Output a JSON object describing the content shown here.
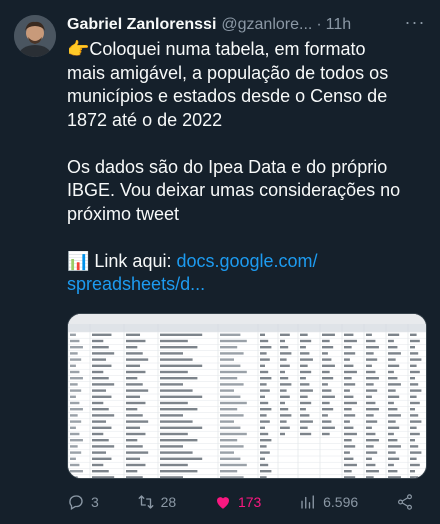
{
  "tweet": {
    "author_name": "Gabriel Zanlorenssi",
    "handle": "@gzanlore...",
    "dot": "·",
    "time": "11h",
    "more_label": "···",
    "line1": "👉Coloquei numa tabela, em formato",
    "line2": "mais amigável, a população de todos os",
    "line3": "municípios e estados desde o Censo de",
    "line4": "1872 até o de 2022",
    "line5": "Os dados são do Ipea Data e do próprio",
    "line6": "IBGE. Vou deixar umas considerações no",
    "line7": "próximo tweet",
    "link_prefix": "📊 Link aqui: ",
    "link_line1": "docs.google.com/",
    "link_line2": "spreadsheets/d..."
  },
  "actions": {
    "replies": "3",
    "retweets": "28",
    "likes": "173",
    "views": "6.596"
  },
  "colors": {
    "background": "#15202b",
    "link": "#1d9bf0",
    "like": "#f91880",
    "muted": "#8b98a5"
  }
}
